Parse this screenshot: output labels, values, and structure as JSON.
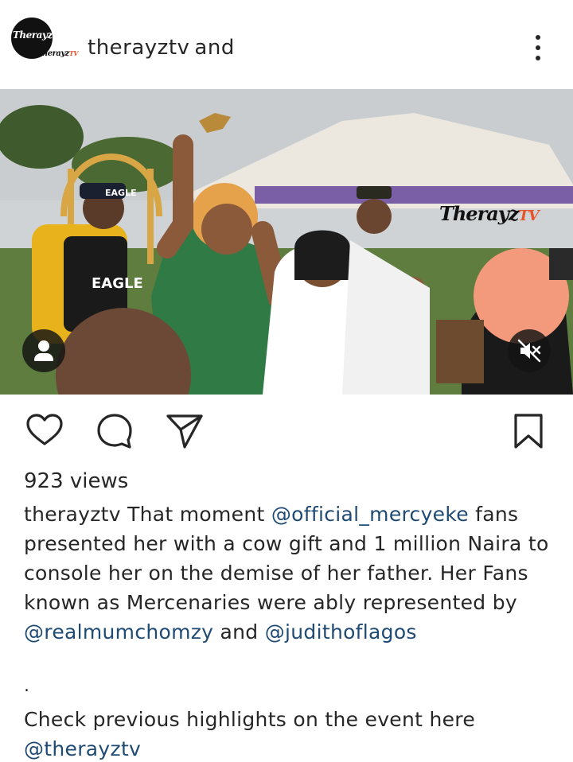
{
  "header": {
    "username": "therayztv",
    "collab_word": "and",
    "avatar": {
      "logo_text": "Therayz",
      "logo_tv": "TV"
    },
    "more_icon": "more-vertical-icon"
  },
  "media": {
    "type": "video",
    "watermark": {
      "text": "Therayz",
      "tv": "TV"
    },
    "tag_icon": "person-tag-icon",
    "mute_icon": "speaker-muted-icon",
    "shirt_text": "EAGLE",
    "cap_text": "EAGLE"
  },
  "actions": {
    "like_icon": "heart-icon",
    "comment_icon": "comment-bubble-icon",
    "share_icon": "send-arrow-icon",
    "save_icon": "bookmark-icon"
  },
  "stats": {
    "views": "923 views"
  },
  "caption": {
    "username": "therayztv",
    "line1_text": "That moment",
    "mention1": "@official_mercyeke",
    "line1_tail": "fans",
    "line2": "presented her with a cow gift and 1 million Naira to",
    "line3": "console her on the demise of her father. Her Fans",
    "line4": "known as Mercenaries were ably represented by",
    "mention2": "@realmumchomzy",
    "and_word": "and",
    "mention3": "@judithoflagos",
    "separator": ".",
    "extra_text": "Check previous highlights on the event here",
    "mention4": "@therayztv"
  },
  "colors": {
    "text": "#262626",
    "mention": "#1e4a73",
    "overlay_button": "#141414",
    "brand_orange": "#e8542a"
  }
}
